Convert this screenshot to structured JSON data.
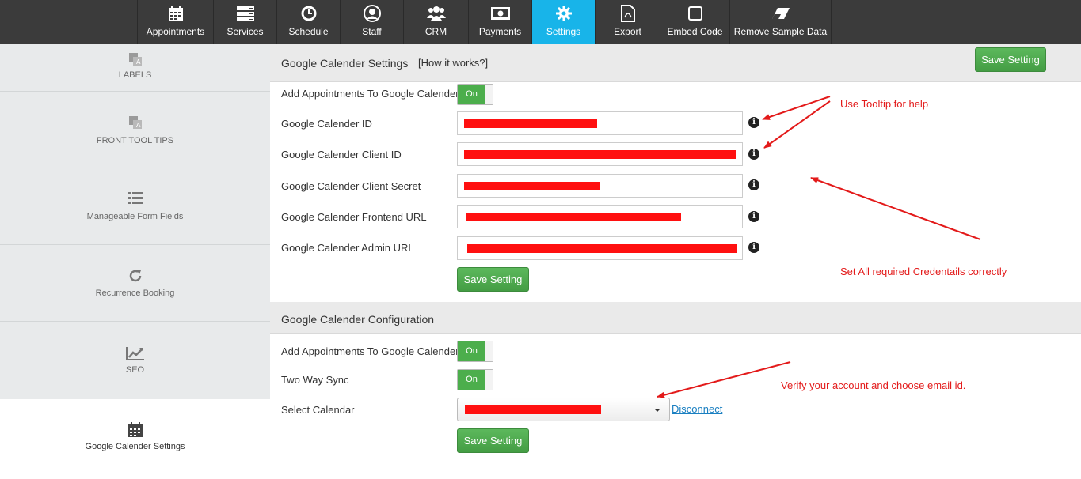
{
  "nav": {
    "items": [
      {
        "label": "Appointments",
        "icon": "calendar-icon"
      },
      {
        "label": "Services",
        "icon": "server-icon"
      },
      {
        "label": "Schedule",
        "icon": "clock-icon"
      },
      {
        "label": "Staff",
        "icon": "user-icon"
      },
      {
        "label": "CRM",
        "icon": "users-icon"
      },
      {
        "label": "Payments",
        "icon": "money-icon"
      },
      {
        "label": "Settings",
        "icon": "gear-icon"
      },
      {
        "label": "Export",
        "icon": "pdf-icon"
      },
      {
        "label": "Embed Code",
        "icon": "square-icon"
      },
      {
        "label": "Remove Sample Data",
        "icon": "eraser-icon"
      }
    ],
    "active": "Settings",
    "active_color": "#18b4e9",
    "bar_color": "#3b3b3b"
  },
  "sidebar": {
    "items": [
      {
        "label": "LABELS",
        "icon": "translate-icon"
      },
      {
        "label": "FRONT TOOL TIPS",
        "icon": "translate-icon"
      },
      {
        "label": "Manageable Form Fields",
        "icon": "list-icon"
      },
      {
        "label": "Recurrence Booking",
        "icon": "refresh-icon"
      },
      {
        "label": "SEO",
        "icon": "line-chart-icon"
      },
      {
        "label": "Google Calender Settings",
        "icon": "calendar-icon"
      }
    ],
    "active": "Google Calender Settings"
  },
  "settings": {
    "title": "Google Calender Settings",
    "how_link": "[How it works?]",
    "save_label": "Save Setting",
    "add_appointments_label": "Add Appointments To Google Calender",
    "toggle_on": "On",
    "fields": [
      {
        "label": "Google Calender ID"
      },
      {
        "label": "Google Calender Client ID"
      },
      {
        "label": "Google Calender Client Secret"
      },
      {
        "label": "Google Calender Frontend URL"
      },
      {
        "label": "Google Calender Admin URL"
      }
    ]
  },
  "config": {
    "title": "Google Calender Configuration",
    "add_appointments_label": "Add Appointments To Google Calender",
    "two_way_label": "Two Way Sync",
    "select_label": "Select Calendar",
    "toggle_on": "On",
    "disconnect": "Disconnect",
    "save_label": "Save Setting"
  },
  "annotations": {
    "tooltip_note": "Use Tooltip for help",
    "credentials_note": "Set All required Credentails correctly",
    "verify_note": "Verify your account and choose email id.",
    "color": "#e31a1a"
  }
}
